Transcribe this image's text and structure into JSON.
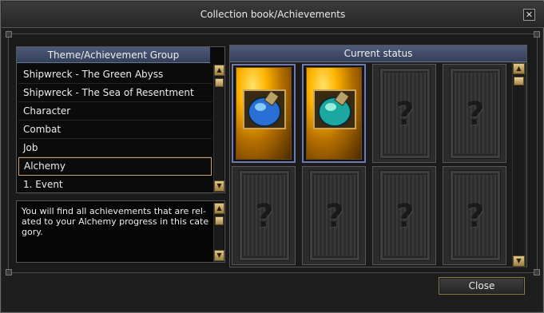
{
  "window": {
    "title": "Collection book/Achievements",
    "close_glyph": "✕"
  },
  "group_list": {
    "header": "Theme/Achievement Group",
    "items": [
      {
        "label": "Shipwreck - The Green Abyss",
        "selected": false
      },
      {
        "label": "Shipwreck - The Sea of Resentment",
        "selected": false
      },
      {
        "label": "Character",
        "selected": false
      },
      {
        "label": "Combat",
        "selected": false
      },
      {
        "label": "Job",
        "selected": false
      },
      {
        "label": "Alchemy",
        "selected": true
      },
      {
        "label": "1. Event",
        "selected": false
      }
    ]
  },
  "description": {
    "text": "You will find all achievements that are rel­ated to your Alchemy progress in this cate gory."
  },
  "status": {
    "header": "Current status",
    "cards": [
      {
        "state": "unlocked",
        "icon": "potion-blue-icon"
      },
      {
        "state": "unlocked",
        "icon": "potion-teal-icon"
      },
      {
        "state": "locked",
        "icon": "question-mark-icon"
      },
      {
        "state": "locked",
        "icon": "question-mark-icon"
      },
      {
        "state": "locked",
        "icon": "question-mark-icon"
      },
      {
        "state": "locked",
        "icon": "question-mark-icon"
      },
      {
        "state": "locked",
        "icon": "question-mark-icon"
      },
      {
        "state": "locked",
        "icon": "question-mark-icon"
      }
    ]
  },
  "footer": {
    "close_label": "Close"
  },
  "colors": {
    "header_blue": "#3e4a6a",
    "selected_border": "#c8a27a",
    "scroll_gold": "#c9a45a"
  },
  "icons": {
    "up": "▲",
    "down": "▼",
    "question": "?"
  }
}
